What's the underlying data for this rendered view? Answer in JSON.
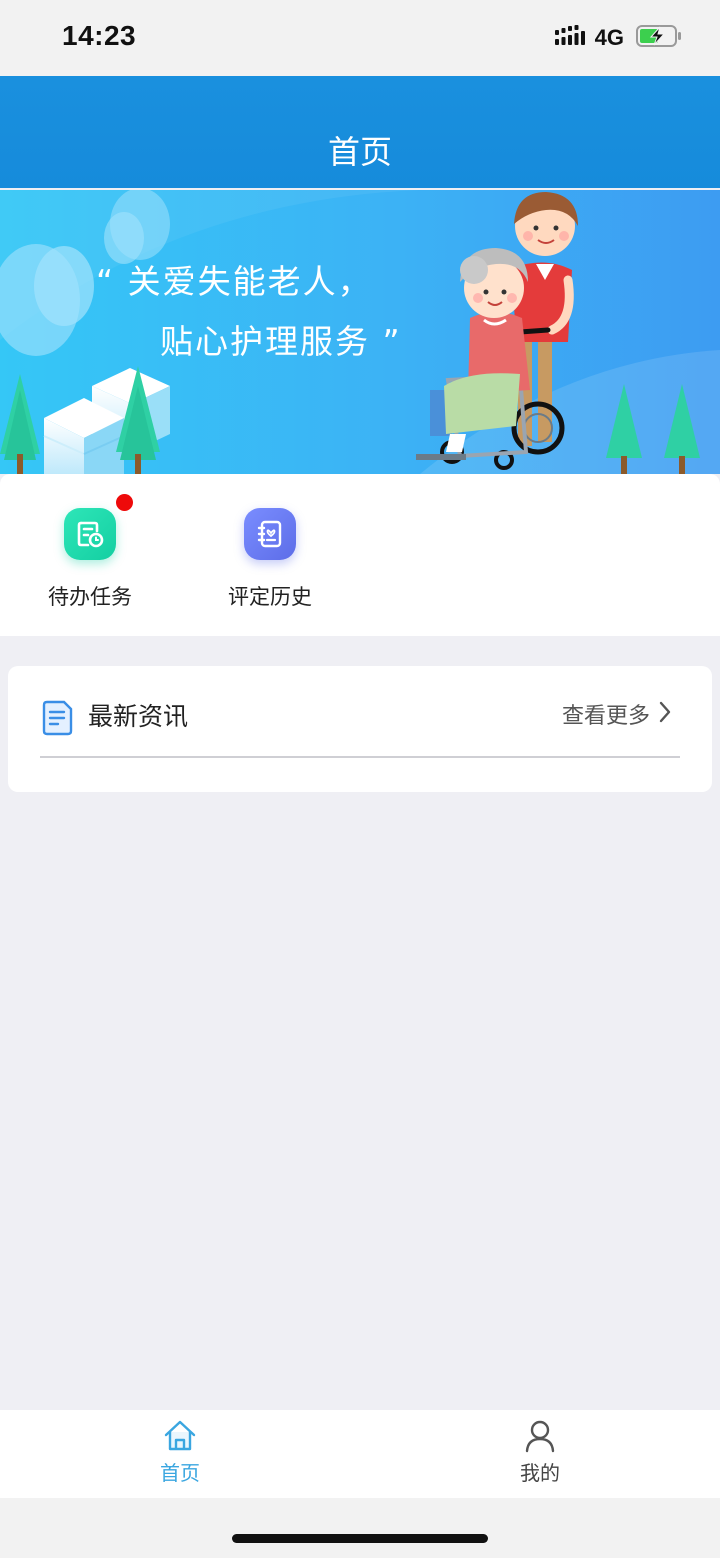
{
  "status_bar": {
    "time": "14:23",
    "network": "4G",
    "icons": [
      "signal-icon",
      "battery-charging-icon"
    ]
  },
  "header": {
    "title": "首页"
  },
  "banner": {
    "slogan_line1": "“ 关爱失能老人，",
    "slogan_line2": "贴心护理服务 ”"
  },
  "quick_actions": [
    {
      "label": "待办任务",
      "icon": "task-document-icon",
      "color": "#1fd9ad",
      "has_badge": true
    },
    {
      "label": "评定历史",
      "icon": "history-contacts-icon",
      "color": "#6a7cf4",
      "has_badge": false
    }
  ],
  "news": {
    "title": "最新资讯",
    "more_label": "查看更多",
    "icon": "news-document-icon"
  },
  "tab_bar": {
    "items": [
      {
        "label": "首页",
        "icon": "home-icon",
        "active": true
      },
      {
        "label": "我的",
        "icon": "person-icon",
        "active": false
      }
    ],
    "active_color": "#3aa6e0"
  },
  "colors": {
    "header_blue": "#168bdb",
    "page_background": "#efeff4",
    "badge_red": "#ee0a0a"
  }
}
